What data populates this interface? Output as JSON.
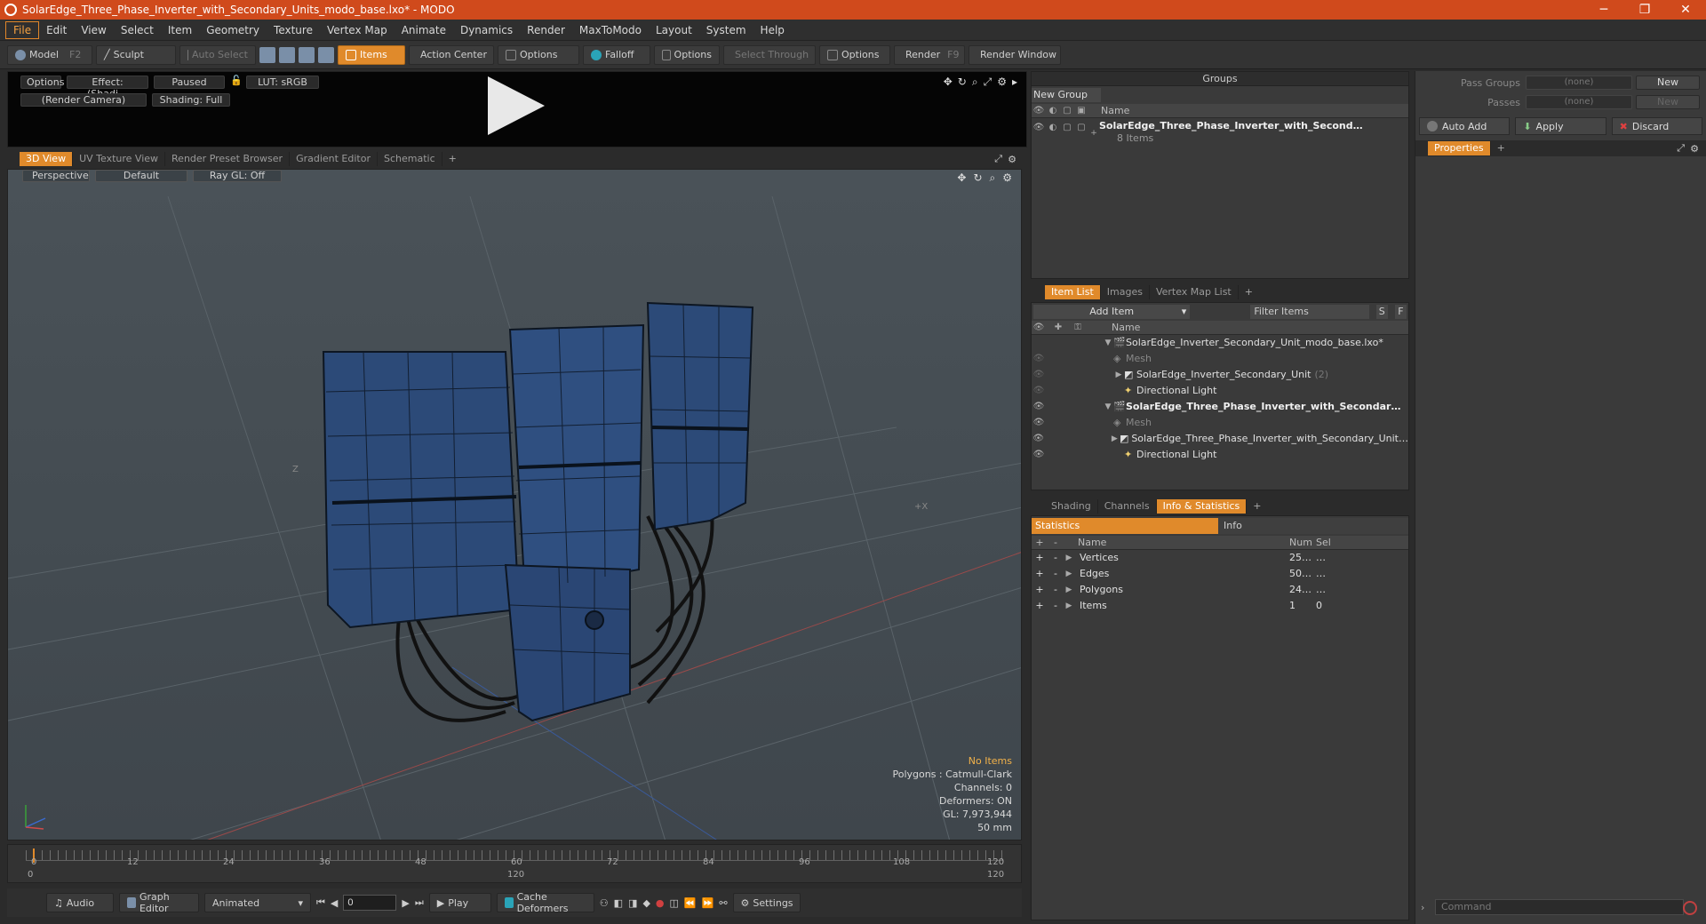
{
  "window": {
    "title": "SolarEdge_Three_Phase_Inverter_with_Secondary_Units_modo_base.lxo* - MODO",
    "minimize": "─",
    "maximize": "❐",
    "close": "✕"
  },
  "menu": [
    "File",
    "Edit",
    "View",
    "Select",
    "Item",
    "Geometry",
    "Texture",
    "Vertex Map",
    "Animate",
    "Dynamics",
    "Render",
    "MaxToModo",
    "Layout",
    "System",
    "Help"
  ],
  "toolbar": {
    "model": "Model",
    "model_key": "F2",
    "sculpt": "Sculpt",
    "auto_select": "Auto Select",
    "items": "Items",
    "action_center": "Action Center",
    "options1": "Options",
    "falloff": "Falloff",
    "options2": "Options",
    "select_through": "Select Through",
    "options3": "Options",
    "render": "Render",
    "render_key": "F9",
    "render_window": "Render Window"
  },
  "preview": {
    "options": "Options",
    "effect": "Effect: (Shadi…",
    "paused": "Paused",
    "lut": "LUT: sRGB",
    "camera": "(Render Camera)",
    "shading": "Shading: Full"
  },
  "view_tabs": [
    "3D View",
    "UV Texture View",
    "Render Preset Browser",
    "Gradient Editor",
    "Schematic",
    "+"
  ],
  "viewport": {
    "perspective": "Perspective",
    "default": "Default",
    "raygl": "Ray GL: Off",
    "axis_z": "Z",
    "axis_x": "+X",
    "stats": {
      "no_items": "No Items",
      "polygons": "Polygons : Catmull-Clark",
      "channels": "Channels: 0",
      "deformers": "Deformers: ON",
      "gl": "GL: 7,973,944",
      "mm": "50 mm"
    }
  },
  "timeline": {
    "ticks": [
      "0",
      "12",
      "24",
      "36",
      "48",
      "60",
      "72",
      "84",
      "96",
      "108",
      "120"
    ],
    "start": "0",
    "mid": "120",
    "end": "120"
  },
  "bottom": {
    "audio": "Audio",
    "graph_editor": "Graph Editor",
    "animated": "Animated",
    "frame": "0",
    "play": "Play",
    "cache": "Cache Deformers",
    "settings": "Settings"
  },
  "groups": {
    "title": "Groups",
    "new_group": "New Group",
    "name_col": "Name",
    "item_name": "SolarEdge_Three_Phase_Inverter_with_Second…",
    "item_count": "8 Items"
  },
  "item_list": {
    "tabs": [
      "Item List",
      "Images",
      "Vertex Map List",
      "+"
    ],
    "add_item": "Add Item",
    "filter": "Filter Items",
    "s": "S",
    "f": "F",
    "name_col": "Name",
    "rows": [
      {
        "label": "SolarEdge_Inverter_Secondary_Unit_modo_base.lxo*",
        "extra": ""
      },
      {
        "label": "Mesh",
        "extra": ""
      },
      {
        "label": "SolarEdge_Inverter_Secondary_Unit",
        "extra": "(2)"
      },
      {
        "label": "Directional Light",
        "extra": ""
      },
      {
        "label": "SolarEdge_Three_Phase_Inverter_with_Secondar…",
        "extra": ""
      },
      {
        "label": "Mesh",
        "extra": ""
      },
      {
        "label": "SolarEdge_Three_Phase_Inverter_with_Secondary_Unit…",
        "extra": ""
      },
      {
        "label": "Directional Light",
        "extra": ""
      }
    ]
  },
  "stats_panel": {
    "tabs": [
      "Shading",
      "Channels",
      "Info & Statistics",
      "+"
    ],
    "statistics": "Statistics",
    "info": "Info",
    "cols": {
      "name": "Name",
      "num": "Num",
      "sel": "Sel"
    },
    "rows": [
      {
        "name": "Vertices",
        "num": "25…",
        "sel": "…"
      },
      {
        "name": "Edges",
        "num": "50…",
        "sel": "…"
      },
      {
        "name": "Polygons",
        "num": "24…",
        "sel": "…"
      },
      {
        "name": "Items",
        "num": "1",
        "sel": "0"
      }
    ]
  },
  "properties": {
    "pass_groups": "Pass Groups",
    "passes": "Passes",
    "none": "(none)",
    "new": "New",
    "auto_add": "Auto Add",
    "apply": "Apply",
    "discard": "Discard",
    "tab": "Properties",
    "plus": "+",
    "command": "Command"
  },
  "colors": {
    "accent": "#e08a2b",
    "titlebar": "#d04a1c",
    "mesh": "#2c4a78"
  }
}
